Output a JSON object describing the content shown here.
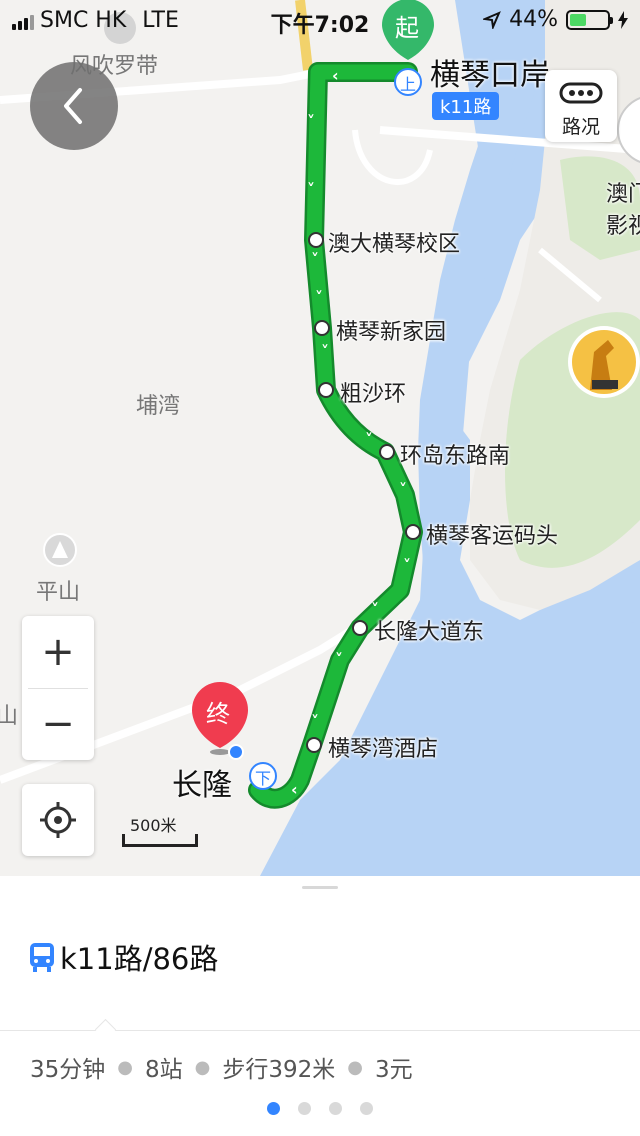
{
  "status_bar": {
    "carrier": "SMC HK",
    "network": "LTE",
    "time": "下午7:02",
    "battery": "44%",
    "battery_level": 0.44
  },
  "map": {
    "place_labels": [
      "风吹罗带",
      "埔湾",
      "平山",
      "山",
      "澳门",
      "影视"
    ],
    "start_marker": "起",
    "end_marker": "终",
    "start_station": "横琴口岸",
    "end_station": "长隆",
    "board_icon": "上",
    "alight_icon": "下",
    "route_badge": "k11路",
    "stops": [
      "澳大横琴校区",
      "横琴新家园",
      "粗沙环",
      "环岛东路南",
      "横琴客运码头",
      "长隆大道东",
      "横琴湾酒店"
    ],
    "traffic_label": "路况",
    "zoom_in": "+",
    "zoom_out": "−",
    "scale": "500米",
    "colors": {
      "route": "#1db83a",
      "water": "#b7d3f5",
      "green": "#d7e8c9",
      "accent": "#3385ff",
      "end_pin": "#f03c4f",
      "start_pin": "#34b86a"
    }
  },
  "panel": {
    "route_title": "k11路/86路",
    "summary": [
      "35分钟",
      "8站",
      "步行392米",
      "3元"
    ],
    "page_count": 4,
    "active_page": 1
  }
}
